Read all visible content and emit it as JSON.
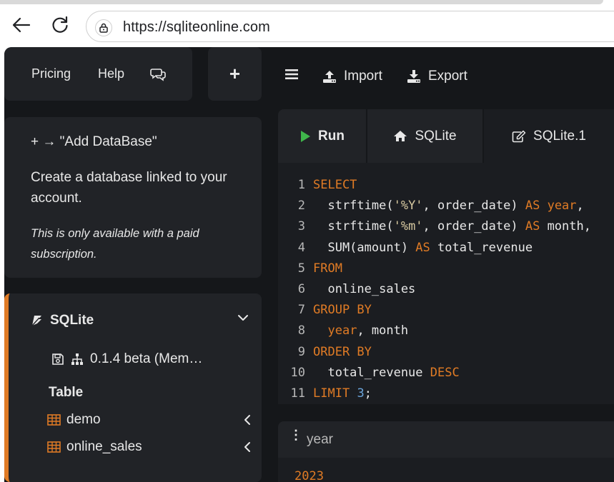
{
  "browser": {
    "url": "https://sqliteonline.com",
    "back_icon": "arrow-left-icon",
    "reload_icon": "reload-icon",
    "lock_icon": "lock-icon"
  },
  "nav": {
    "pricing": "Pricing",
    "help": "Help",
    "chat_icon": "chat-icon",
    "plus": "+"
  },
  "toolbar": {
    "menu_icon": "hamburger-icon",
    "import": "Import",
    "export": "Export"
  },
  "info": {
    "title": "+ → \"Add DataBase\"",
    "description": "Create a database linked to your account.",
    "note": "This is only available with a paid subscription."
  },
  "database": {
    "name": "SQLite",
    "version": "0.1.4 beta (Mem…",
    "table_heading": "Table",
    "tables": [
      "demo",
      "online_sales"
    ]
  },
  "tabs": [
    {
      "label": "Run",
      "icon": "play-icon"
    },
    {
      "label": "SQLite",
      "icon": "home-icon"
    },
    {
      "label": "SQLite.1",
      "icon": "edit-icon"
    }
  ],
  "editor": {
    "lines": [
      {
        "n": "1",
        "tokens": [
          {
            "t": "SELECT",
            "c": "kw"
          }
        ]
      },
      {
        "n": "2",
        "tokens": [
          {
            "t": "  strftime(",
            "c": "tx"
          },
          {
            "t": "'%Y'",
            "c": "str"
          },
          {
            "t": ", order_date) ",
            "c": "tx"
          },
          {
            "t": "AS",
            "c": "kw"
          },
          {
            "t": " ",
            "c": "tx"
          },
          {
            "t": "year",
            "c": "kw"
          },
          {
            "t": ",",
            "c": "tx"
          }
        ]
      },
      {
        "n": "3",
        "tokens": [
          {
            "t": "  strftime(",
            "c": "tx"
          },
          {
            "t": "'%m'",
            "c": "str"
          },
          {
            "t": ", order_date) ",
            "c": "tx"
          },
          {
            "t": "AS",
            "c": "kw"
          },
          {
            "t": " month,",
            "c": "tx"
          }
        ]
      },
      {
        "n": "4",
        "tokens": [
          {
            "t": "  SUM(amount) ",
            "c": "tx"
          },
          {
            "t": "AS",
            "c": "kw"
          },
          {
            "t": " total_revenue",
            "c": "tx"
          }
        ]
      },
      {
        "n": "5",
        "tokens": [
          {
            "t": "FROM",
            "c": "kw"
          }
        ]
      },
      {
        "n": "6",
        "tokens": [
          {
            "t": "  online_sales",
            "c": "tx"
          }
        ]
      },
      {
        "n": "7",
        "tokens": [
          {
            "t": "GROUP BY",
            "c": "kw"
          }
        ]
      },
      {
        "n": "8",
        "tokens": [
          {
            "t": "  ",
            "c": "tx"
          },
          {
            "t": "year",
            "c": "kw"
          },
          {
            "t": ", month",
            "c": "tx"
          }
        ]
      },
      {
        "n": "9",
        "tokens": [
          {
            "t": "ORDER BY",
            "c": "kw"
          }
        ]
      },
      {
        "n": "10",
        "tokens": [
          {
            "t": "  total_revenue ",
            "c": "tx"
          },
          {
            "t": "DESC",
            "c": "kw"
          }
        ]
      },
      {
        "n": "11",
        "tokens": [
          {
            "t": "LIMIT",
            "c": "kw"
          },
          {
            "t": " ",
            "c": "tx"
          },
          {
            "t": "3",
            "c": "num"
          },
          {
            "t": ";",
            "c": "tx"
          }
        ]
      }
    ]
  },
  "result": {
    "column": "year",
    "first_value": "2023"
  },
  "colors": {
    "accent": "#e07b25",
    "run_green": "#3fb54b",
    "background": "#15171a",
    "panel": "#212327"
  }
}
